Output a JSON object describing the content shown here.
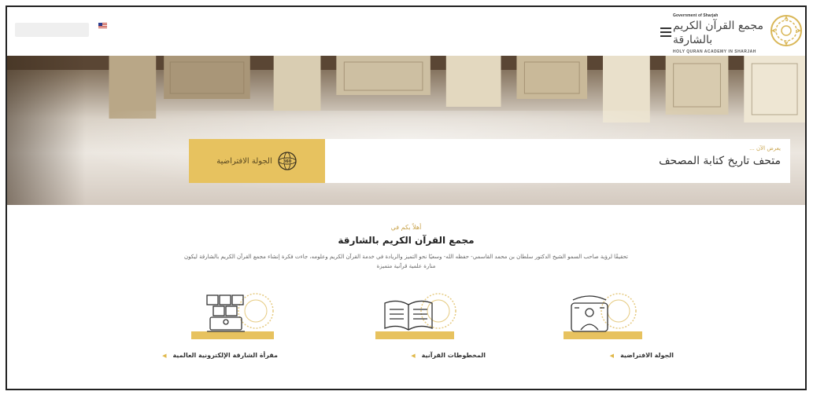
{
  "header": {
    "language_label": "",
    "logo": {
      "government_line": "Government of Sharjah",
      "arabic_name": "مجمع القرآن الكريم بالشارقة",
      "english_name": "HOLY QURAN ACADEMY IN SHARJAH"
    }
  },
  "hero": {
    "now_showing_kicker": "يعرض الآن ...",
    "now_showing_title": "متحف تاريخ كتابة المصحف",
    "tour_button_label": "الجولة الافتراضية",
    "tour_icon": "360-globe-icon"
  },
  "welcome": {
    "kicker": "أهلاً بكم في",
    "title": "مجمع القرآن الكريم بالشارقة",
    "description": "تحقيقًا لرؤية صاحب السمو الشيخ الدكتور سلطان بن محمد القاسمي- حفظه الله- وسعيًا نحو التميز والريادة في خدمة القرآن الكريم وعلومه، جاءت فكرة إنشاء مجمع القرآن الكريم بالشارقة ليكون منارة علمية قرآنية متميزة"
  },
  "features": [
    {
      "label": "الجولة الافتراضية",
      "icon": "virtual-tour-icon"
    },
    {
      "label": "المخطوطات القرآنية",
      "icon": "open-book-icon"
    },
    {
      "label": "مقرأة الشارقة الإلكترونية العالمية",
      "icon": "online-reading-icon"
    }
  ],
  "colors": {
    "accent": "#e7c25f",
    "accent_text": "#c9a44d",
    "line_art": "#444444"
  }
}
